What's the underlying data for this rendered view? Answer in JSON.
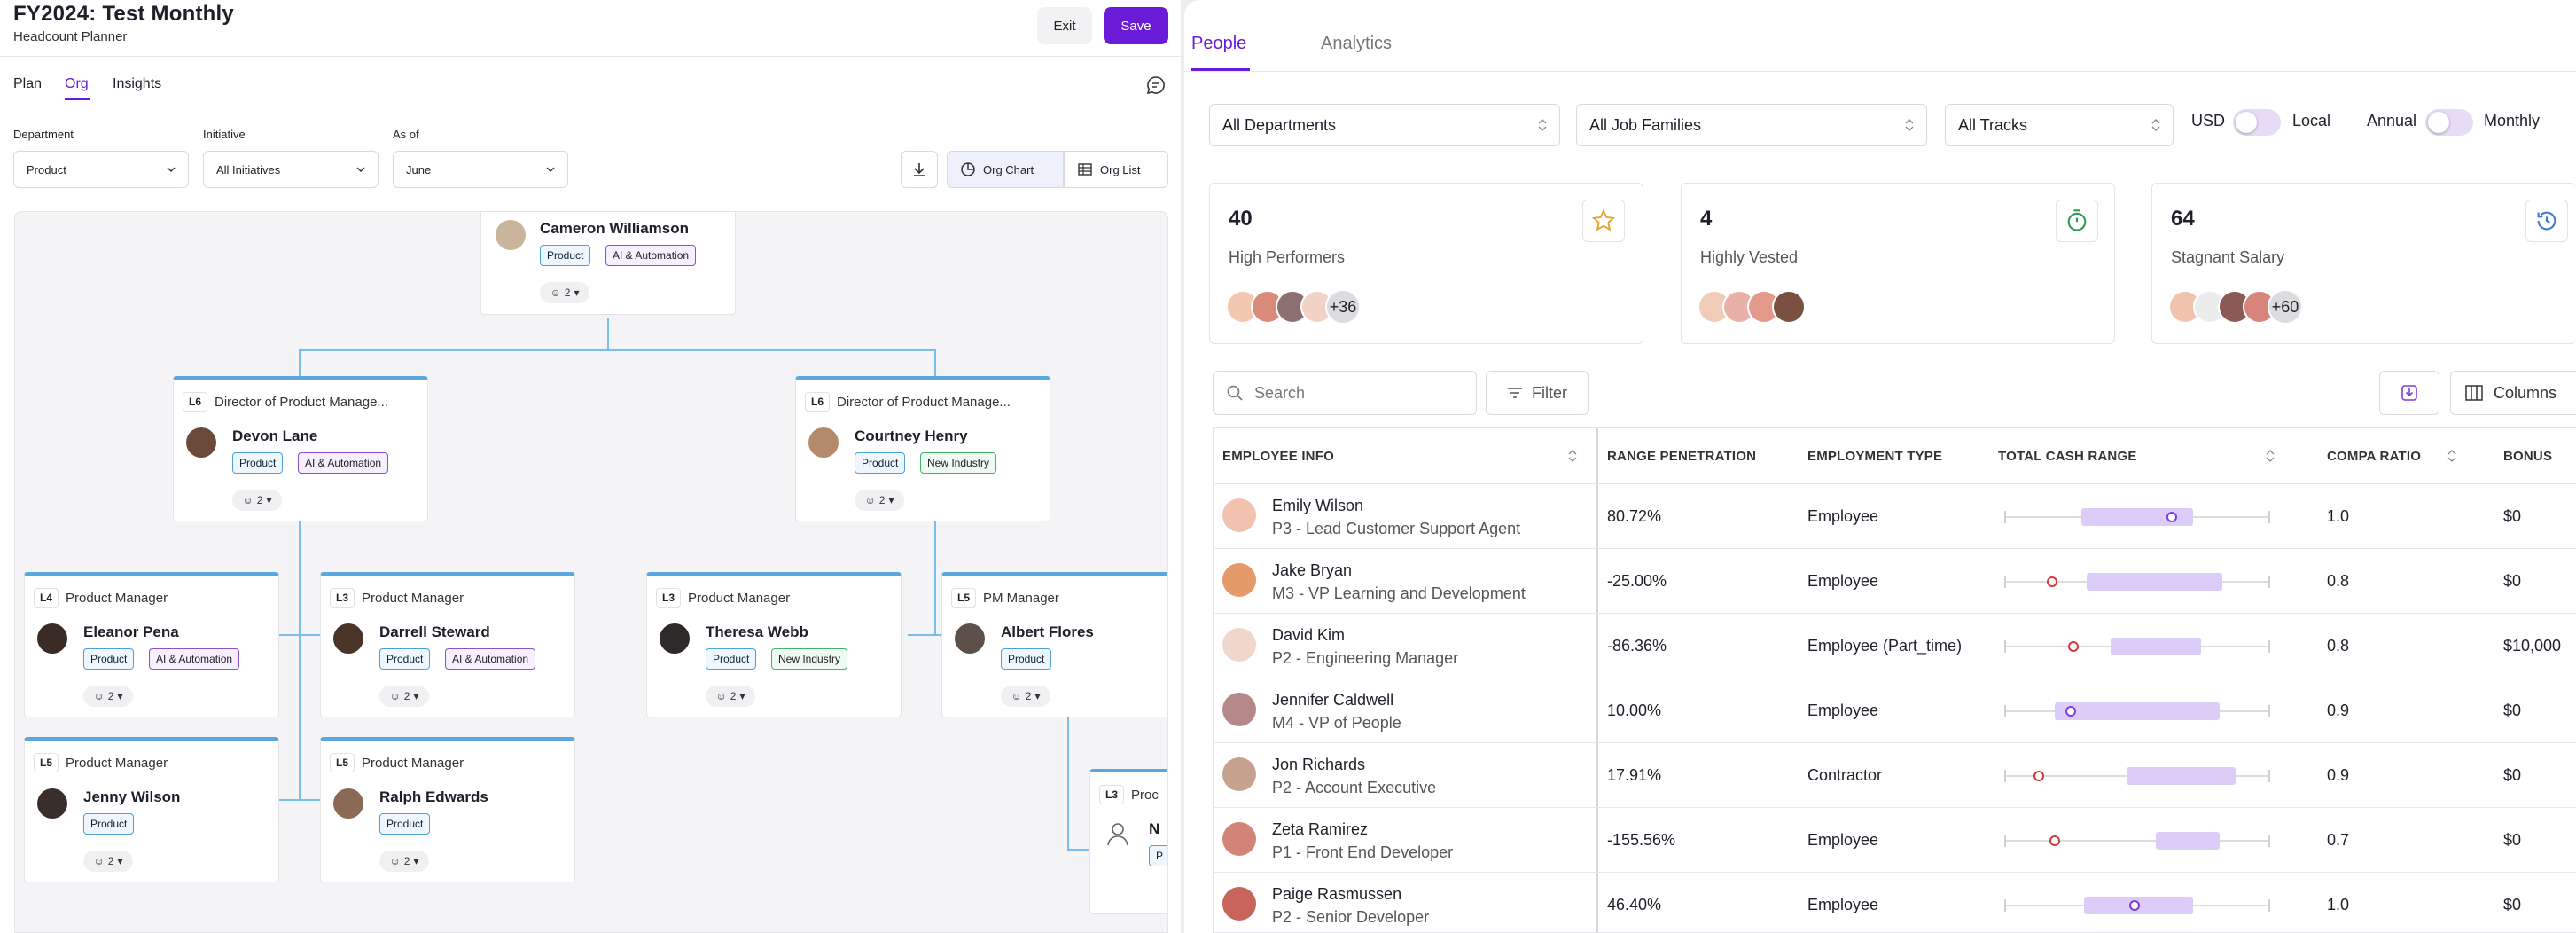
{
  "header": {
    "title": "FY2024: Test Monthly",
    "subtitle": "Headcount Planner",
    "exit_label": "Exit",
    "save_label": "Save"
  },
  "left_tabs": [
    {
      "label": "Plan"
    },
    {
      "label": "Org",
      "active": true
    },
    {
      "label": "Insights"
    }
  ],
  "filters": {
    "department": {
      "label": "Department",
      "value": "Product"
    },
    "initiative": {
      "label": "Initiative",
      "value": "All Initiatives"
    },
    "as_of": {
      "label": "As of",
      "value": "June"
    }
  },
  "view_toggle": {
    "org_chart": "Org Chart",
    "org_list": "Org List"
  },
  "org_nodes": {
    "root": {
      "name": "Cameron Williamson",
      "tags": [
        "Product",
        "AI & Automation"
      ],
      "count": "2"
    },
    "devon": {
      "level": "L6",
      "role": "Director of Product Manage...",
      "name": "Devon Lane",
      "tags": [
        "Product",
        "AI & Automation"
      ],
      "count": "2"
    },
    "courtney": {
      "level": "L6",
      "role": "Director of Product Manage...",
      "name": "Courtney Henry",
      "tags": [
        "Product",
        "New Industry"
      ],
      "count": "2"
    },
    "eleanor": {
      "level": "L4",
      "role": "Product Manager",
      "name": "Eleanor Pena",
      "tags": [
        "Product",
        "AI & Automation"
      ],
      "count": "2"
    },
    "darrell": {
      "level": "L3",
      "role": "Product Manager",
      "name": "Darrell Steward",
      "tags": [
        "Product",
        "AI & Automation"
      ],
      "count": "2"
    },
    "theresa": {
      "level": "L3",
      "role": "Product Manager",
      "name": "Theresa Webb",
      "tags": [
        "Product",
        "New Industry"
      ],
      "count": "2"
    },
    "albert": {
      "level": "L5",
      "role": "PM Manager",
      "name": "Albert Flores",
      "tags": [
        "Product"
      ],
      "count": "2"
    },
    "jenny": {
      "level": "L5",
      "role": "Product Manager",
      "name": "Jenny Wilson",
      "tags": [
        "Product"
      ],
      "count": "2"
    },
    "ralph": {
      "level": "L5",
      "role": "Product Manager",
      "name": "Ralph Edwards",
      "tags": [
        "Product"
      ],
      "count": "2"
    },
    "partial": {
      "level": "L3",
      "role": "Proc",
      "name": "N",
      "tags": [
        "P"
      ]
    }
  },
  "right_tabs": [
    {
      "label": "People",
      "active": true
    },
    {
      "label": "Analytics"
    }
  ],
  "right_filters": {
    "departments": "All Departments",
    "job_families": "All Job Families",
    "tracks": "All Tracks"
  },
  "toggles": {
    "currency_left": "USD",
    "currency_right": "Local",
    "period_left": "Annual",
    "period_right": "Monthly"
  },
  "stats": [
    {
      "value": "40",
      "label": "High Performers",
      "more": "+36",
      "icon": "star-icon",
      "color": "#e0a526"
    },
    {
      "value": "4",
      "label": "Highly Vested",
      "icon": "stopwatch-icon",
      "color": "#2f9a52"
    },
    {
      "value": "64",
      "label": "Stagnant Salary",
      "more": "+60",
      "icon": "history-icon",
      "color": "#3a7bd5"
    }
  ],
  "table_tools": {
    "search_placeholder": "Search",
    "filter_label": "Filter",
    "columns_label": "Columns"
  },
  "table": {
    "headers": [
      "EMPLOYEE INFO",
      "RANGE PENETRATION",
      "EMPLOYMENT TYPE",
      "TOTAL CASH RANGE",
      "COMPA RATIO",
      "BONUS"
    ],
    "rows": [
      {
        "name": "Emily Wilson",
        "role": "P3 - Lead Customer Support Agent",
        "penetration": "80.72%",
        "type": "Employee",
        "compa": "1.0",
        "bonus": "$0",
        "range_lo": 0.29,
        "range_hi": 0.71,
        "pos": 0.63,
        "in_range": true
      },
      {
        "name": "Jake Bryan",
        "role": "M3 - VP Learning and Development",
        "penetration": "-25.00%",
        "type": "Employee",
        "compa": "0.8",
        "bonus": "$0",
        "range_lo": 0.31,
        "range_hi": 0.82,
        "pos": 0.18,
        "in_range": false
      },
      {
        "name": "David Kim",
        "role": "P2 - Engineering Manager",
        "penetration": "-86.36%",
        "type": "Employee (Part_time)",
        "compa": "0.8",
        "bonus": "$10,000",
        "range_lo": 0.4,
        "range_hi": 0.74,
        "pos": 0.26,
        "in_range": false
      },
      {
        "name": "Jennifer Caldwell",
        "role": "M4 - VP of People",
        "penetration": "10.00%",
        "type": "Employee",
        "compa": "0.9",
        "bonus": "$0",
        "range_lo": 0.19,
        "range_hi": 0.81,
        "pos": 0.25,
        "in_range": true
      },
      {
        "name": "Jon Richards",
        "role": "P2 - Account Executive",
        "penetration": "17.91%",
        "type": "Contractor",
        "compa": "0.9",
        "bonus": "$0",
        "range_lo": 0.46,
        "range_hi": 0.87,
        "pos": 0.13,
        "in_range": false
      },
      {
        "name": "Zeta Ramirez",
        "role": "P1 - Front End Developer",
        "penetration": "-155.56%",
        "type": "Employee",
        "compa": "0.7",
        "bonus": "$0",
        "range_lo": 0.57,
        "range_hi": 0.81,
        "pos": 0.19,
        "in_range": false
      },
      {
        "name": "Paige Rasmussen",
        "role": "P2 - Senior Developer",
        "penetration": "46.40%",
        "type": "Employee",
        "compa": "1.0",
        "bonus": "$0",
        "range_lo": 0.3,
        "range_hi": 0.71,
        "pos": 0.49,
        "in_range": true
      }
    ]
  }
}
